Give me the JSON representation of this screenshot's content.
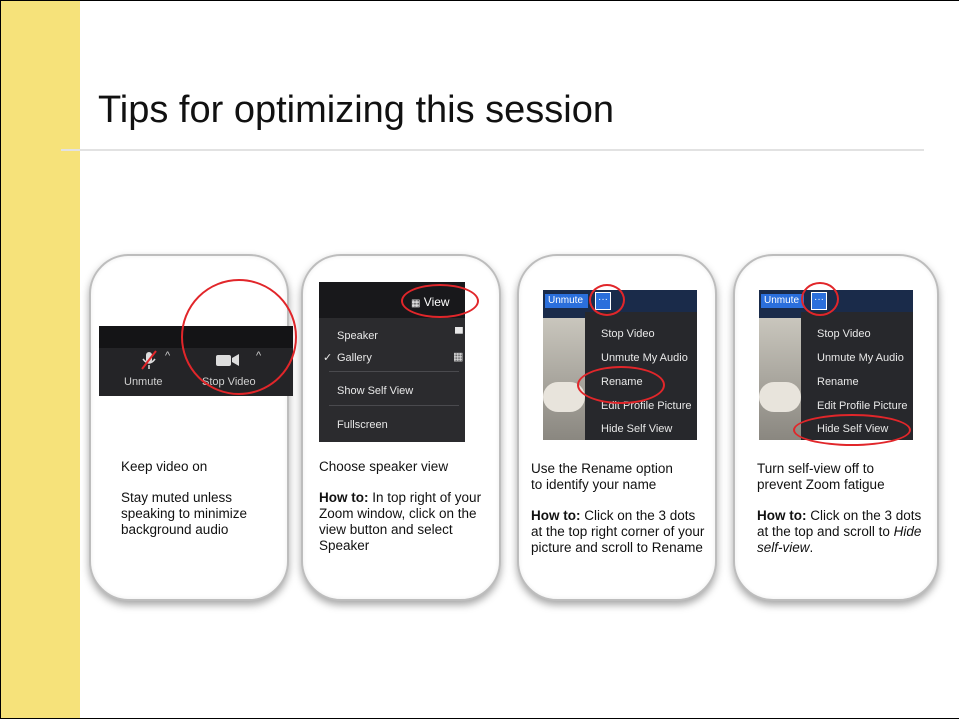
{
  "slide": {
    "title": "Tips for optimizing this session"
  },
  "cards": [
    {
      "headline": "Keep video on",
      "body": "Stay muted unless\nspeaking to minimize\nbackground audio",
      "toolbar": {
        "unmute": "Unmute",
        "stop_video": "Stop Video"
      }
    },
    {
      "headline": "Choose speaker view",
      "howto_label": "How to:",
      "howto_text": " In top right of your Zoom window, click on the view button and select Speaker",
      "menu": {
        "view_button": "View",
        "speaker": "Speaker",
        "gallery": "Gallery",
        "show_self_view": "Show Self View",
        "fullscreen": "Fullscreen"
      }
    },
    {
      "headline": "Use the Rename option\nto identify your name",
      "howto_label": "How to:",
      "howto_text": " Click on the 3 dots at the top right corner of your picture and scroll to Rename",
      "menu": {
        "unmute_tag": "Unmute",
        "dots": "···",
        "stop_video": "Stop Video",
        "unmute_audio": "Unmute My Audio",
        "rename": "Rename",
        "edit_picture": "Edit Profile Picture",
        "hide_self": "Hide Self View"
      }
    },
    {
      "headline": "Turn self-view off to\nprevent Zoom fatigue",
      "howto_label": "How to:",
      "howto_text": " Click on the 3 dots at the top and scroll to ",
      "howto_italic": "Hide self-view",
      "howto_end": ".",
      "menu": {
        "unmute_tag": "Unmute",
        "dots": "···",
        "stop_video": "Stop Video",
        "unmute_audio": "Unmute My Audio",
        "rename": "Rename",
        "edit_picture": "Edit Profile Picture",
        "hide_self": "Hide Self View"
      }
    }
  ],
  "colors": {
    "accent": "#f6e27a",
    "highlight": "#e1262a",
    "zoom_blue": "#2b6fdc"
  }
}
